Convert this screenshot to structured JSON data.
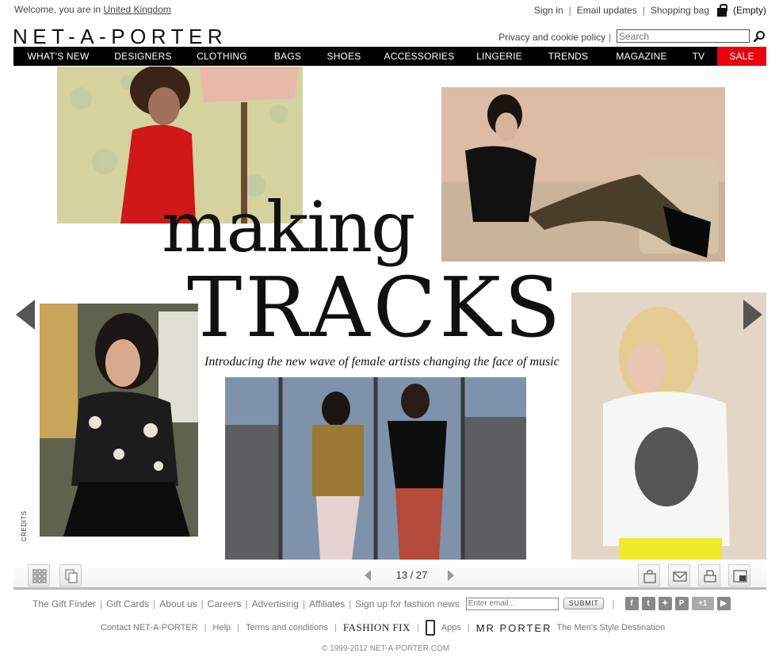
{
  "util": {
    "welcome_prefix": "Welcome, you are in",
    "country": "United Kingdom",
    "sign_in": "Sign in",
    "email_updates": "Email updates",
    "shopping_bag": "Shopping bag",
    "bag_status": "(Empty)"
  },
  "brand": {
    "logo": "NET-A-PORTER"
  },
  "header": {
    "privacy": "Privacy and cookie policy",
    "search_placeholder": "Search"
  },
  "nav": {
    "items": [
      "WHAT'S NEW",
      "DESIGNERS",
      "CLOTHING",
      "BAGS",
      "SHOES",
      "ACCESSORIES",
      "LINGERIE",
      "TRENDS",
      "MAGAZINE",
      "TV",
      "SALE"
    ]
  },
  "feature": {
    "headline_1": "making",
    "headline_2": "TRACKS",
    "subline": "Introducing the new wave of female artists changing the face of music",
    "credits": "CREDITS"
  },
  "pager": {
    "label": "13 / 27"
  },
  "footer": {
    "links_1": [
      "The Gift Finder",
      "Gift Cards",
      "About us",
      "Careers",
      "Advertising",
      "Affiliates",
      "Sign up for fashion news"
    ],
    "email_placeholder": "Enter email...",
    "submit": "SUBMIT",
    "contact": "Contact NET-A-PORTER",
    "help": "Help",
    "terms": "Terms and conditions",
    "fashion_fix": "FASHION FIX",
    "apps": "Apps",
    "mr_porter": "MR PORTER",
    "mr_porter_tagline": "The Men's Style Destination",
    "copyright": "© 1999-2012 NET-A-PORTER.COM"
  },
  "colors": {
    "nav_bg": "#000000",
    "sale_bg": "#e8000f",
    "text": "#333333"
  }
}
